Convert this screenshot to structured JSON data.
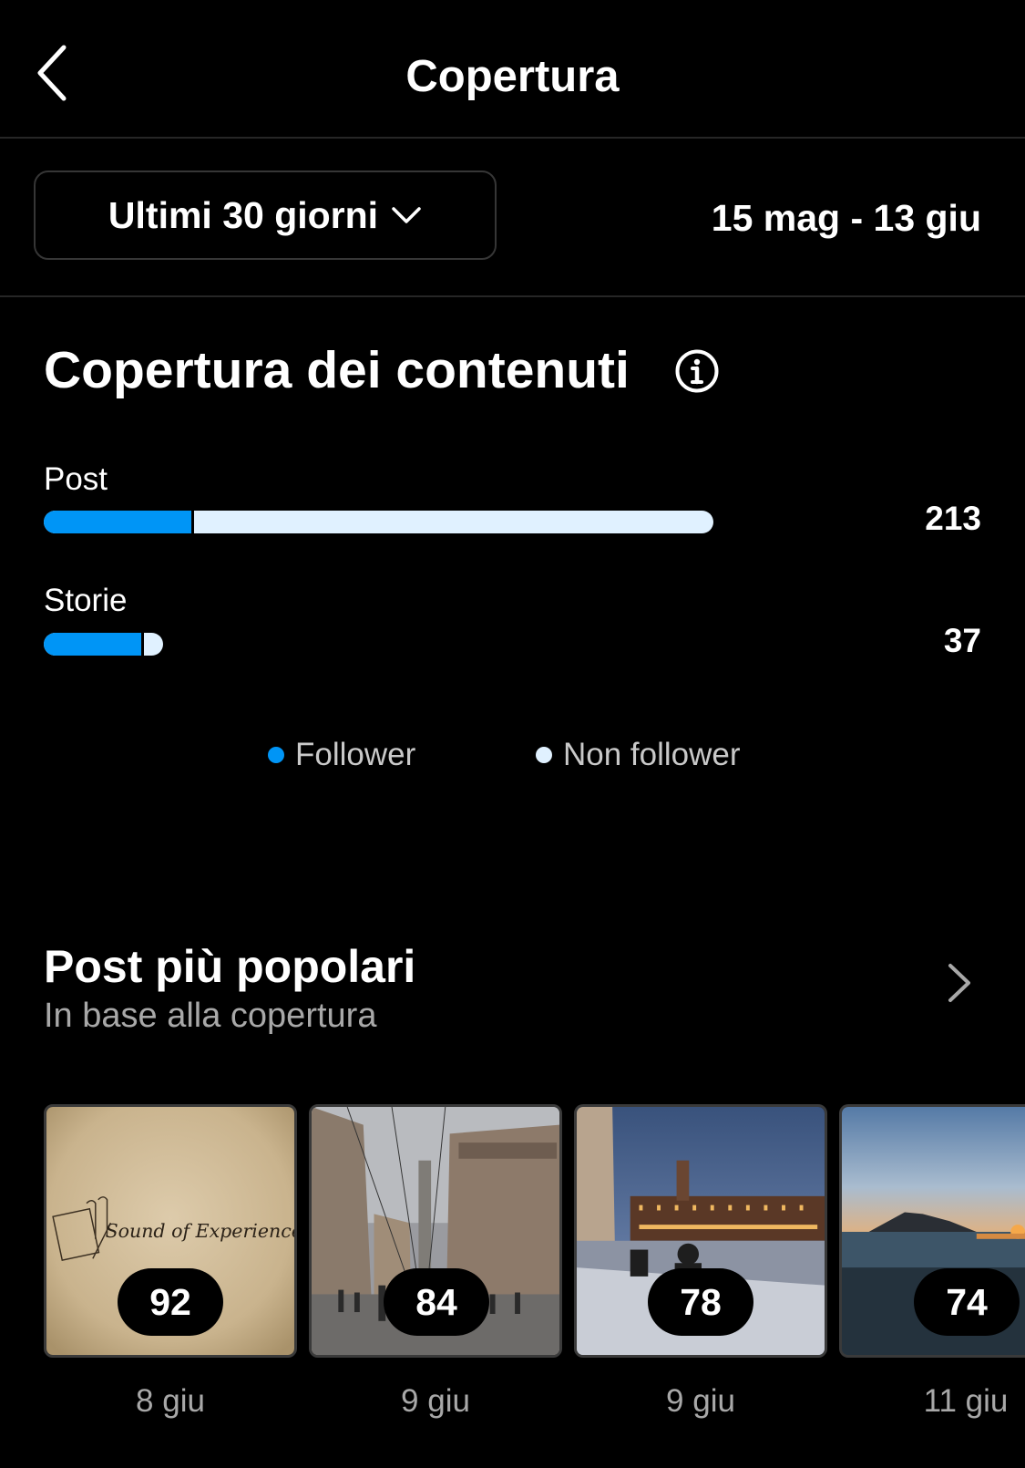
{
  "header": {
    "title": "Copertura"
  },
  "filter": {
    "range_label": "Ultimi 30 giorni",
    "date_range": "15 mag - 13 giu"
  },
  "reach": {
    "title": "Copertura dei contenuti",
    "rows": [
      {
        "label": "Post",
        "value": "213",
        "follower_fraction": 0.22
      },
      {
        "label": "Storie",
        "value": "37",
        "follower_fraction": 0.82
      }
    ],
    "legend": [
      {
        "label": "Follower",
        "color": "#0095f6"
      },
      {
        "label": "Non follower",
        "color": "#e0f1ff"
      }
    ]
  },
  "popular": {
    "title": "Post più popolari",
    "subtitle": "In base alla copertura",
    "posts": [
      {
        "value": "92",
        "date": "8 giu",
        "caption": "Sound of Experience"
      },
      {
        "value": "84",
        "date": "9 giu"
      },
      {
        "value": "78",
        "date": "9 giu"
      },
      {
        "value": "74",
        "date": "11 giu"
      }
    ]
  }
}
